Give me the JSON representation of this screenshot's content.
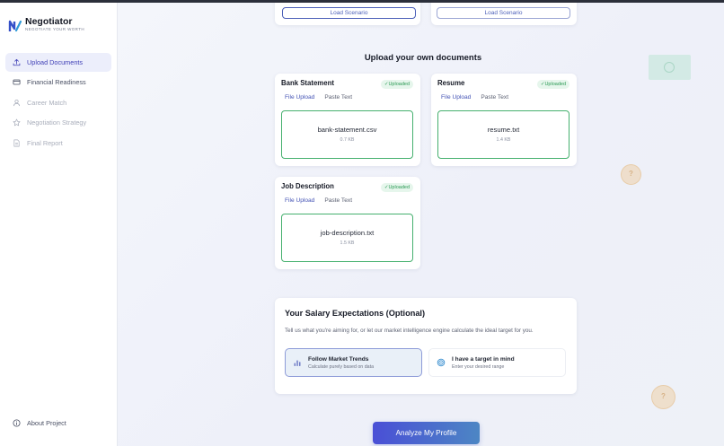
{
  "app": {
    "name": "Negotiator",
    "tagline": "NEGOTIATE YOUR WORTH"
  },
  "sidebar": {
    "items": [
      {
        "label": "Upload Documents",
        "icon": "upload-icon",
        "state": "active"
      },
      {
        "label": "Financial Readiness",
        "icon": "card-icon",
        "state": "enabled"
      },
      {
        "label": "Career Match",
        "icon": "user-icon",
        "state": "disabled"
      },
      {
        "label": "Negotiation Strategy",
        "icon": "star-icon",
        "state": "disabled"
      },
      {
        "label": "Final Report",
        "icon": "document-icon",
        "state": "disabled"
      }
    ],
    "about_label": "About Project"
  },
  "scenarios": {
    "load_label": "Load Scenario"
  },
  "upload": {
    "section_title": "Upload your own documents",
    "tab_file": "File Upload",
    "tab_paste": "Paste Text",
    "uploaded_badge": "✓Uploaded",
    "documents": [
      {
        "title": "Bank Statement",
        "file_name": "bank-statement.csv",
        "file_size": "0.7 KB"
      },
      {
        "title": "Resume",
        "file_name": "resume.txt",
        "file_size": "1.4 KB"
      },
      {
        "title": "Job Description",
        "file_name": "job-description.txt",
        "file_size": "1.5 KB"
      }
    ]
  },
  "salary": {
    "title": "Your Salary Expectations (Optional)",
    "subtitle": "Tell us what you're aiming for, or let our market intelligence engine calculate the ideal target for you.",
    "options": [
      {
        "title": "Follow Market Trends",
        "desc": "Calculate purely based on data",
        "icon": "bar-chart-icon",
        "selected": true
      },
      {
        "title": "I have a target in mind",
        "desc": "Enter your desired range",
        "icon": "target-icon",
        "selected": false
      }
    ]
  },
  "actions": {
    "analyze_label": "Analyze My Profile"
  },
  "colors": {
    "accent": "#4453b5",
    "success": "#2c9a55",
    "cta_start": "#4a4fd6",
    "cta_end": "#4c86c4"
  }
}
